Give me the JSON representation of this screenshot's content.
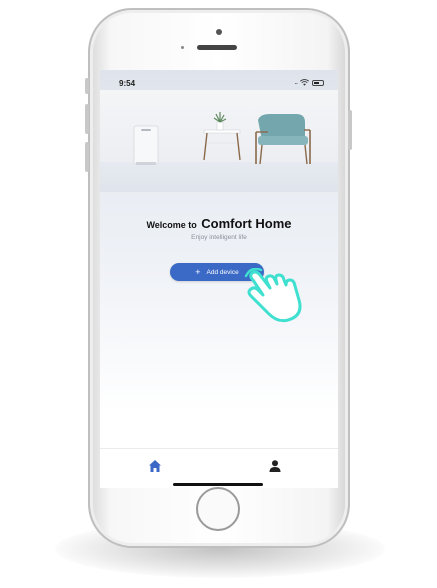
{
  "status_bar": {
    "time": "9:54",
    "dots": "...."
  },
  "hero": {
    "image_alt_icon": "room-illustration"
  },
  "welcome": {
    "prefix": "Welcome to",
    "brand": "Comfort Home",
    "subtitle": "Enjoy intelligent life"
  },
  "actions": {
    "add_device_label": "Add device",
    "plus_glyph": "+"
  },
  "tabs": {
    "home_icon": "home-icon",
    "profile_icon": "person-icon"
  },
  "colors": {
    "accent": "#3b69c6",
    "hand_outline": "#3fe0d0"
  }
}
